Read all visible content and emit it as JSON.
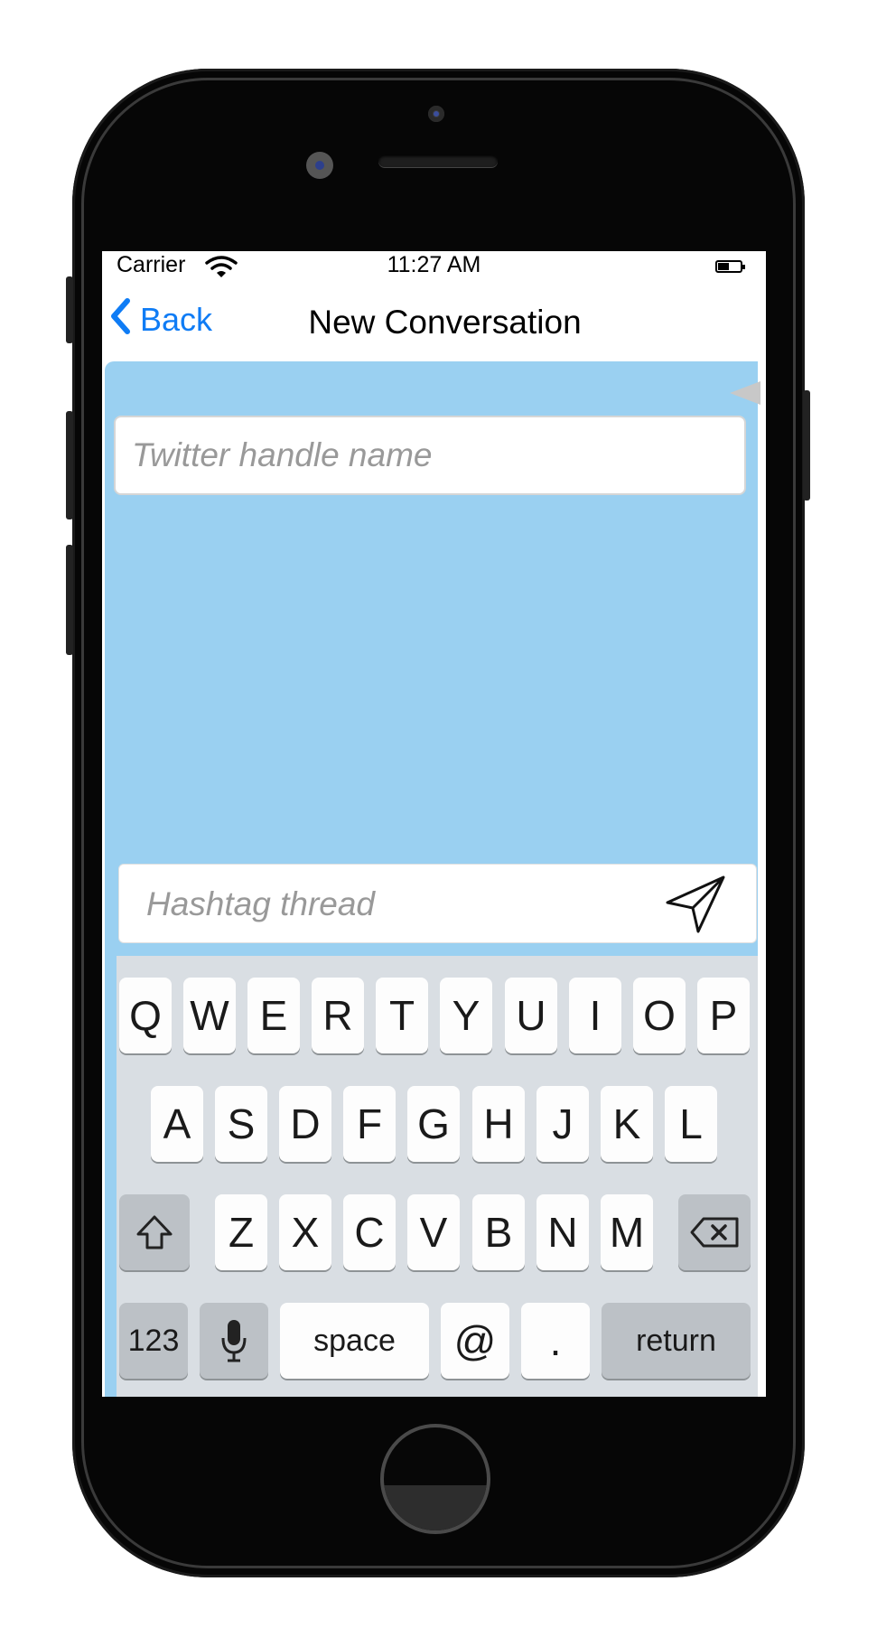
{
  "status_bar": {
    "carrier": "Carrier",
    "time": "11:27 AM"
  },
  "nav_bar": {
    "back_label": "Back",
    "title": "New Conversation"
  },
  "form": {
    "handle_placeholder": "Twitter handle name",
    "hashtag_placeholder": "Hashtag thread"
  },
  "keyboard": {
    "row1": [
      "Q",
      "W",
      "E",
      "R",
      "T",
      "Y",
      "U",
      "I",
      "O",
      "P"
    ],
    "row2": [
      "A",
      "S",
      "D",
      "F",
      "G",
      "H",
      "J",
      "K",
      "L"
    ],
    "row3": [
      "Z",
      "X",
      "C",
      "V",
      "B",
      "N",
      "M"
    ],
    "numbers_label": "123",
    "space_label": "space",
    "at_label": "@",
    "period_label": ".",
    "return_label": "return"
  },
  "colors": {
    "accent": "#0f7cf5",
    "content_background": "#9ad0f1",
    "keyboard_background": "#d9dee3"
  }
}
